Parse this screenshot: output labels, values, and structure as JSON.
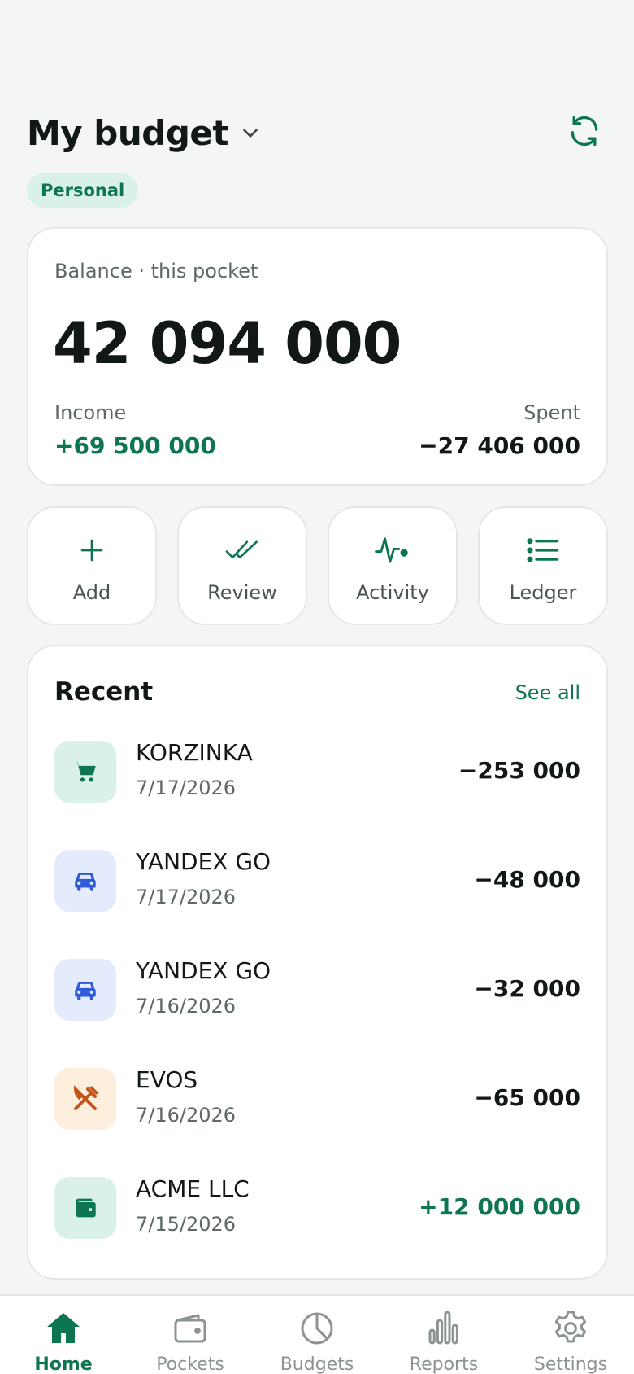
{
  "header": {
    "title": "My budget",
    "badge": "Personal"
  },
  "balance": {
    "label": "Balance · this pocket",
    "amount": "42 094 000",
    "income_label": "Income",
    "income_value": "+69 500 000",
    "spent_label": "Spent",
    "spent_value": "−27 406 000"
  },
  "actions": [
    {
      "label": "Add",
      "icon": "plus-icon"
    },
    {
      "label": "Review",
      "icon": "double-check-icon"
    },
    {
      "label": "Activity",
      "icon": "pulse-icon"
    },
    {
      "label": "Ledger",
      "icon": "list-icon"
    }
  ],
  "recent": {
    "title": "Recent",
    "see_all": "See all",
    "items": [
      {
        "name": "KORZINKA",
        "date": "7/17/2026",
        "amount": "−253 000",
        "icon": "cart-icon",
        "tile": "#d9f1e7",
        "ink": "#0d7550"
      },
      {
        "name": "YANDEX GO",
        "date": "7/17/2026",
        "amount": "−48 000",
        "icon": "car-icon",
        "tile": "#e3ebfd",
        "ink": "#2f5bd8"
      },
      {
        "name": "YANDEX GO",
        "date": "7/16/2026",
        "amount": "−32 000",
        "icon": "car-icon",
        "tile": "#e3ebfd",
        "ink": "#2f5bd8"
      },
      {
        "name": "EVOS",
        "date": "7/16/2026",
        "amount": "−65 000",
        "icon": "utensils-icon",
        "tile": "#fdeedd",
        "ink": "#c2561a"
      },
      {
        "name": "ACME LLC",
        "date": "7/15/2026",
        "amount": "+12 000 000",
        "icon": "wallet-icon",
        "tile": "#d9f1e7",
        "ink": "#0d7550"
      }
    ]
  },
  "nav": {
    "items": [
      {
        "label": "Home",
        "icon": "home-icon",
        "active": true
      },
      {
        "label": "Pockets",
        "icon": "wallet-icon",
        "active": false
      },
      {
        "label": "Budgets",
        "icon": "pie-icon",
        "active": false
      },
      {
        "label": "Reports",
        "icon": "bar-chart-icon",
        "active": false
      },
      {
        "label": "Settings",
        "icon": "gear-icon",
        "active": false
      }
    ]
  },
  "colors": {
    "accent": "#0d7550",
    "accent_soft": "#d9f1e7",
    "background": "#f4f6f5",
    "text": "#121816",
    "muted": "#5e6864"
  }
}
